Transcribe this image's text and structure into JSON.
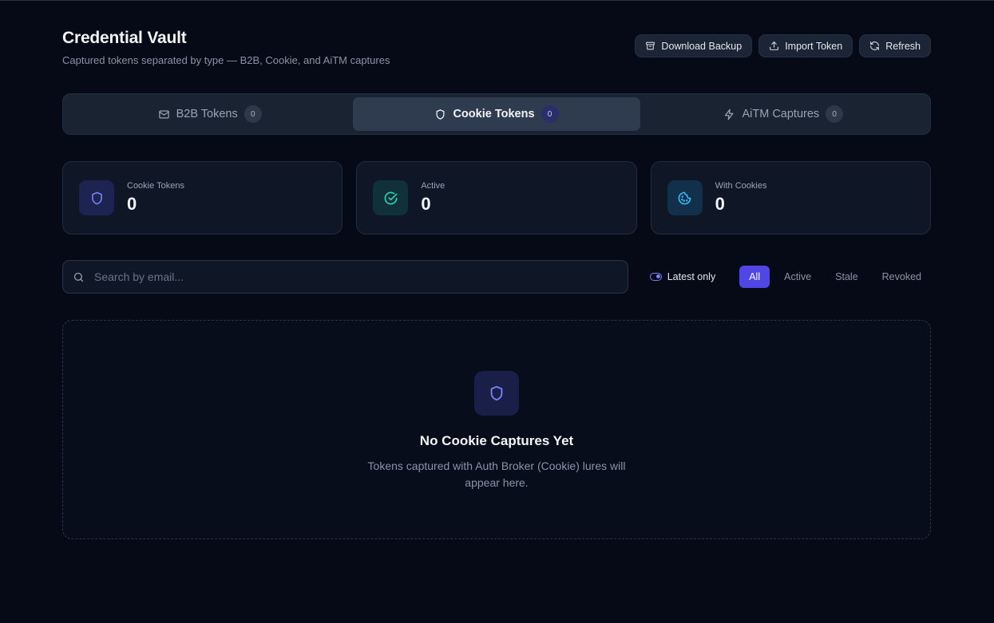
{
  "header": {
    "title": "Credential Vault",
    "subtitle": "Captured tokens separated by type — B2B, Cookie, and AiTM captures",
    "actions": {
      "download_backup": "Download Backup",
      "import_token": "Import Token",
      "refresh": "Refresh"
    }
  },
  "tabs": [
    {
      "label": "B2B Tokens",
      "count": "0",
      "icon": "mail-icon",
      "active": false
    },
    {
      "label": "Cookie Tokens",
      "count": "0",
      "icon": "shield-icon",
      "active": true
    },
    {
      "label": "AiTM Captures",
      "count": "0",
      "icon": "zap-icon",
      "active": false
    }
  ],
  "stats": [
    {
      "label": "Cookie Tokens",
      "value": "0",
      "icon": "shield-icon"
    },
    {
      "label": "Active",
      "value": "0",
      "icon": "check-circle-icon"
    },
    {
      "label": "With Cookies",
      "value": "0",
      "icon": "cookie-icon"
    }
  ],
  "search": {
    "placeholder": "Search by email...",
    "value": ""
  },
  "filters": {
    "toggle_label": "Latest only",
    "options": [
      "All",
      "Active",
      "Stale",
      "Revoked"
    ],
    "selected": "All"
  },
  "empty_state": {
    "title": "No Cookie Captures Yet",
    "text": "Tokens captured with Auth Broker (Cookie) lures will appear here."
  },
  "colors": {
    "background": "#060a17",
    "accent": "#4f46e5",
    "indigo": "#7b80f5",
    "teal": "#2dd4bf",
    "cyan": "#38bdf8"
  }
}
